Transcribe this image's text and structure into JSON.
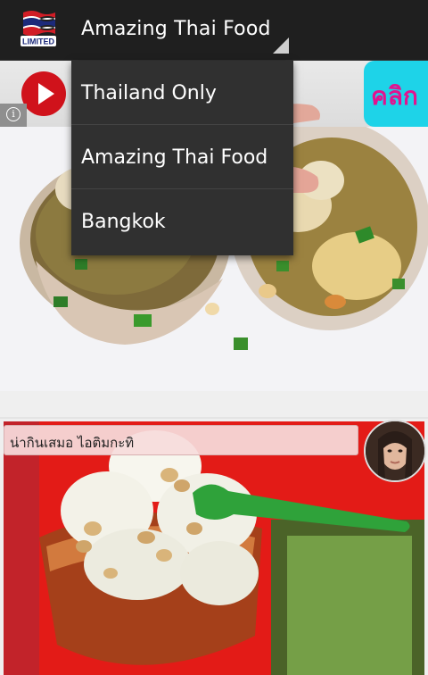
{
  "actionbar": {
    "logo_text": "LIMITED",
    "selected": "Amazing Thai Food"
  },
  "dropdown": {
    "items": [
      {
        "label": "Thailand Only"
      },
      {
        "label": "Amazing Thai Food"
      },
      {
        "label": "Bangkok"
      }
    ]
  },
  "ad": {
    "badge_text": "คลิก"
  },
  "post": {
    "caption": "น่ากินเสมอ ไอติมกะทิ"
  },
  "colors": {
    "actionbar": "#1f1f1f",
    "dropdown": "#303030",
    "play_button": "#d0121b",
    "ad_badge": "#1ed3e8"
  },
  "icons": {
    "app_logo": "thai-flag-limited-logo",
    "spinner": "spinner-triangle-icon",
    "play": "play-icon",
    "info": "info-icon"
  }
}
